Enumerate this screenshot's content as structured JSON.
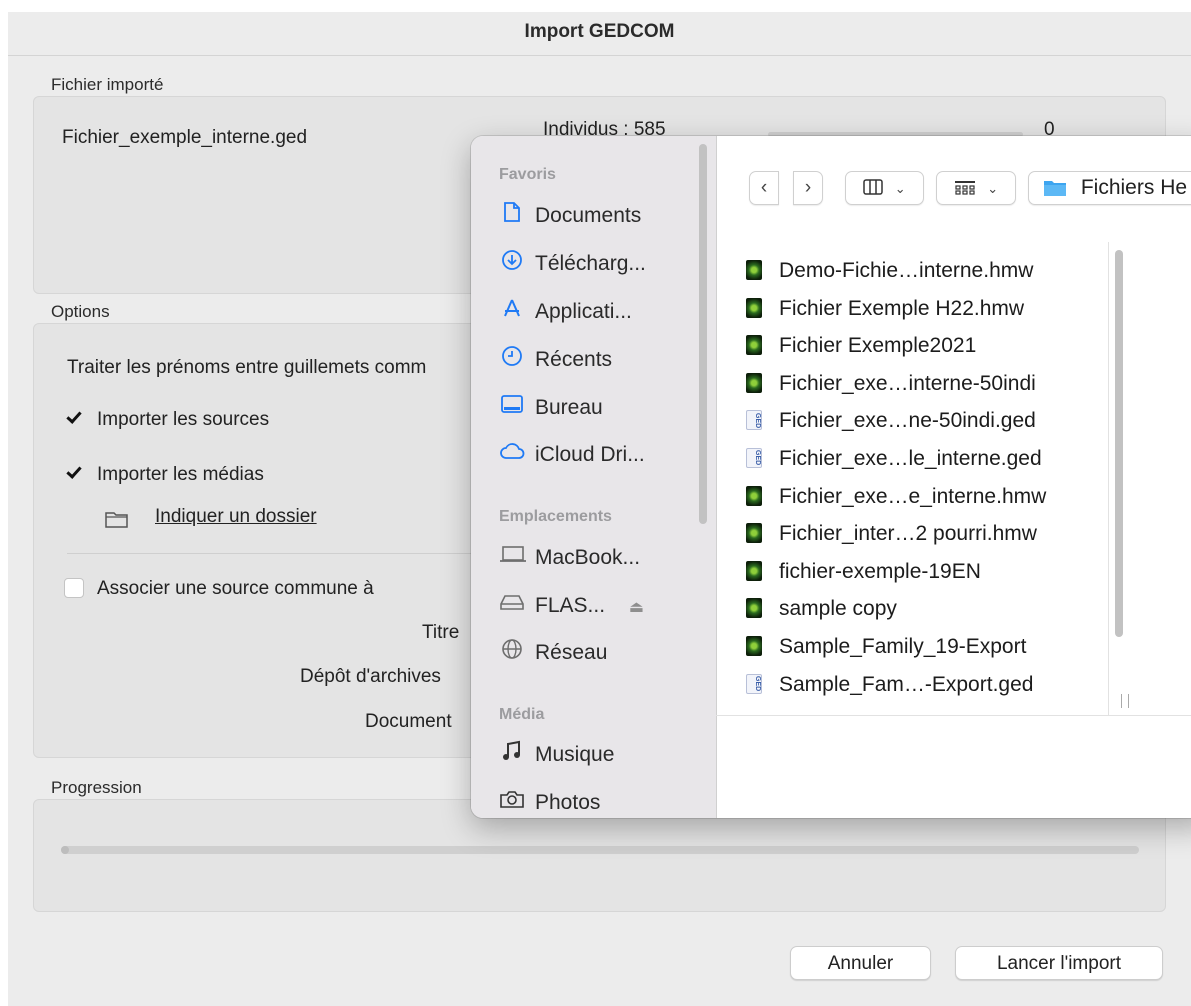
{
  "window": {
    "title": "Import GEDCOM"
  },
  "imported": {
    "section_label": "Fichier importé",
    "filename": "Fichier_exemple_interne.ged",
    "individus_label": "Individus : 585",
    "individus_count": "0"
  },
  "options": {
    "section_label": "Options",
    "prenoms_text": "Traiter les prénoms entre guillemets comm",
    "import_sources": {
      "label": "Importer les sources",
      "checked": true
    },
    "import_medias": {
      "label": "Importer les médias",
      "checked": true
    },
    "folder_link": "Indiquer un dossier",
    "associate_source": {
      "label": "Associer une source commune à",
      "checked": false
    },
    "titre_label": "Titre",
    "depot_label": "Dépôt d'archives",
    "document_label": "Document"
  },
  "progression": {
    "section_label": "Progression",
    "progress": 0
  },
  "buttons": {
    "cancel": "Annuler",
    "start": "Lancer l'import"
  },
  "file_dialog": {
    "sidebar": {
      "favoris_heading": "Favoris",
      "favoris": [
        {
          "label": "Documents",
          "icon": "document-icon"
        },
        {
          "label": "Télécharg...",
          "icon": "download-icon"
        },
        {
          "label": "Applicati...",
          "icon": "applications-icon"
        },
        {
          "label": "Récents",
          "icon": "clock-icon"
        },
        {
          "label": "Bureau",
          "icon": "desktop-icon"
        },
        {
          "label": "iCloud Dri...",
          "icon": "cloud-icon"
        }
      ],
      "emplacements_heading": "Emplacements",
      "emplacements": [
        {
          "label": "MacBook...",
          "icon": "laptop-icon"
        },
        {
          "label": "FLAS...",
          "icon": "drive-icon"
        },
        {
          "label": "Réseau",
          "icon": "network-icon"
        }
      ],
      "media_heading": "Média",
      "media": [
        {
          "label": "Musique",
          "icon": "music-icon"
        },
        {
          "label": "Photos",
          "icon": "camera-icon"
        }
      ]
    },
    "toolbar": {
      "folder_name": "Fichiers He"
    },
    "files": [
      {
        "name": "Demo-Fichie…interne.hmw",
        "type": "hmw"
      },
      {
        "name": "Fichier Exemple H22.hmw",
        "type": "hmw"
      },
      {
        "name": "Fichier Exemple2021",
        "type": "hmw"
      },
      {
        "name": "Fichier_exe…interne-50indi",
        "type": "hmw"
      },
      {
        "name": "Fichier_exe…ne-50indi.ged",
        "type": "ged"
      },
      {
        "name": "Fichier_exe…le_interne.ged",
        "type": "ged"
      },
      {
        "name": "Fichier_exe…e_interne.hmw",
        "type": "hmw"
      },
      {
        "name": "Fichier_inter…2 pourri.hmw",
        "type": "hmw"
      },
      {
        "name": "fichier-exemple-19EN",
        "type": "hmw"
      },
      {
        "name": "sample copy",
        "type": "hmw"
      },
      {
        "name": "Sample_Family_19-Export",
        "type": "hmw"
      },
      {
        "name": "Sample_Fam…-Export.ged",
        "type": "ged"
      }
    ]
  }
}
